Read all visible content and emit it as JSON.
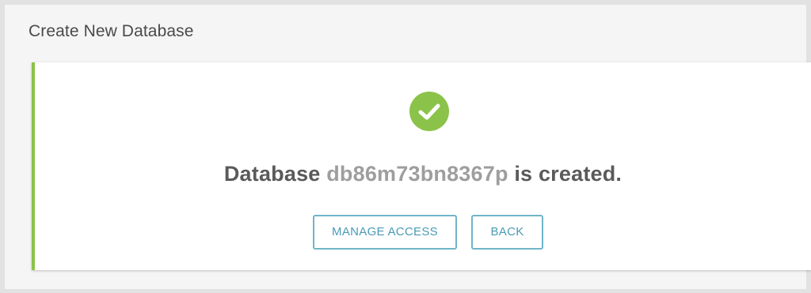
{
  "header": {
    "title": "Create New Database"
  },
  "success_card": {
    "icon": "check-circle-icon",
    "accent_color": "#8bc34a",
    "message_prefix": "Database",
    "database_name": "db86m73bn8367p",
    "message_suffix": "is created."
  },
  "actions": {
    "manage_access_label": "MANAGE ACCESS",
    "back_label": "BACK",
    "button_color": "#4a9ab5"
  }
}
